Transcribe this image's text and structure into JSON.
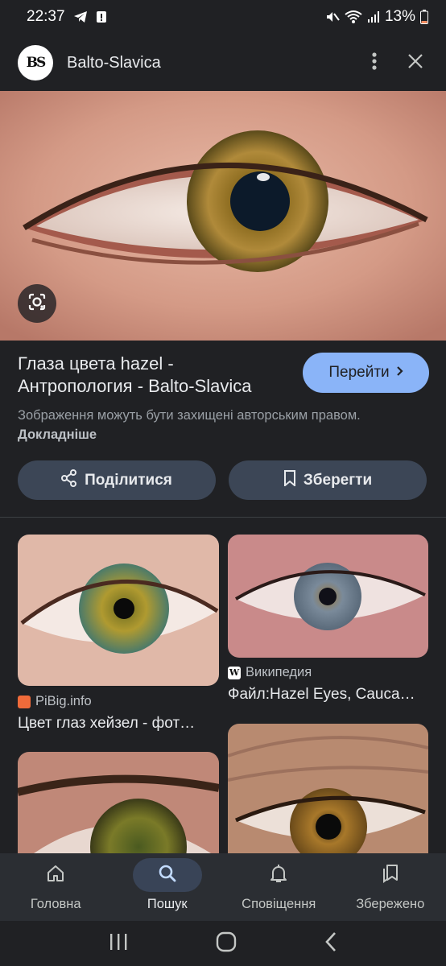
{
  "status_bar": {
    "time": "22:37",
    "battery": "13%"
  },
  "header": {
    "logo_text": "BS",
    "site_name": "Balto-Slavica"
  },
  "result": {
    "title": "Глаза цвета hazel - Антропология - Balto-Slavica",
    "visit_label": "Перейти",
    "copyright_text": "Зображення можуть бути захищені авторським правом.",
    "copyright_link": "Докладніше",
    "share_label": "Поділитися",
    "save_label": "Зберегти"
  },
  "related": [
    {
      "source": "PiBig.info",
      "title": "Цвет глаз хейзел - фот…"
    },
    {
      "source": "Википедия",
      "title": "Файл:Hazel Eyes, Cauca…"
    }
  ],
  "bottom_nav": [
    {
      "label": "Головна",
      "icon": "home-icon"
    },
    {
      "label": "Пошук",
      "icon": "search-icon",
      "active": true
    },
    {
      "label": "Сповіщення",
      "icon": "bell-icon"
    },
    {
      "label": "Збережено",
      "icon": "bookmarks-icon"
    }
  ],
  "colors": {
    "accent": "#8ab4f8",
    "background": "#202124",
    "button": "#3c4656"
  }
}
